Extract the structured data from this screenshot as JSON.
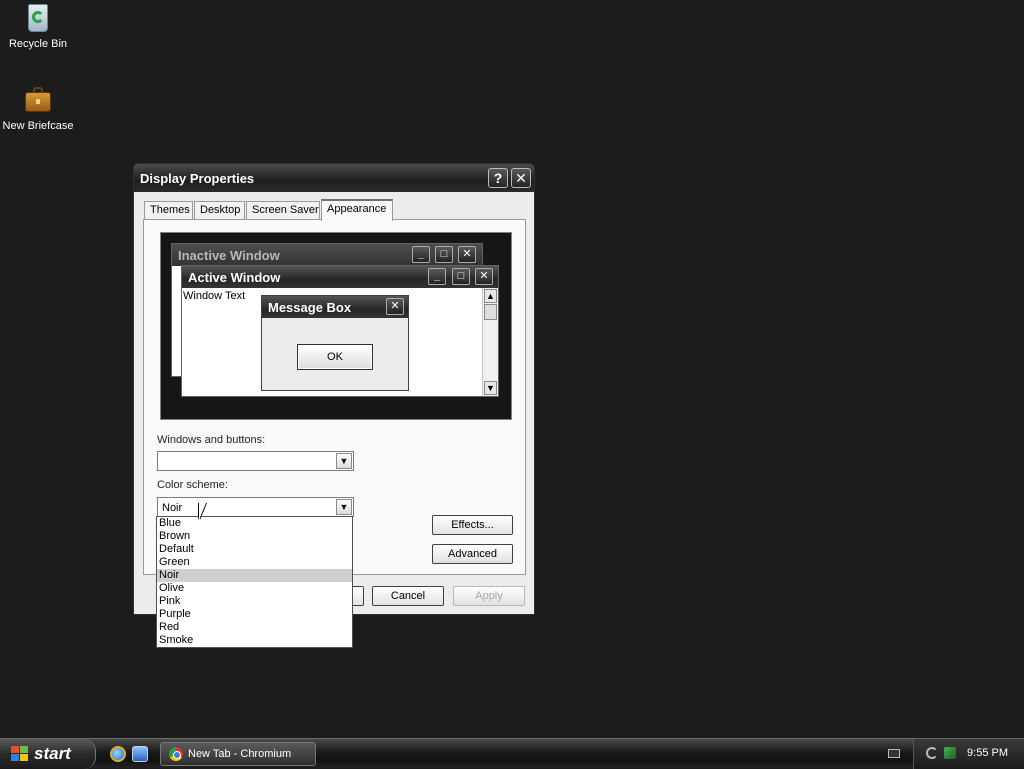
{
  "desktop": {
    "icons": [
      {
        "label": "Recycle Bin",
        "icon": "recycle-bin-icon"
      },
      {
        "label": "New Briefcase",
        "icon": "briefcase-icon"
      }
    ]
  },
  "dialog": {
    "title": "Display Properties",
    "help_symbol": "?",
    "close_symbol": "✕",
    "tabs": [
      {
        "label": "Themes"
      },
      {
        "label": "Desktop"
      },
      {
        "label": "Screen Saver"
      },
      {
        "label": "Appearance",
        "active": true
      }
    ],
    "preview": {
      "inactive_title": "Inactive Window",
      "active_title": "Active Window",
      "window_text": "Window Text",
      "message_box_title": "Message Box",
      "ok_label": "OK"
    },
    "windows_buttons_label": "Windows and buttons:",
    "windows_buttons_value": "",
    "color_scheme_label": "Color scheme:",
    "color_scheme_value": "Noir",
    "effects_label": "Effects...",
    "advanced_label": "Advanced",
    "cancel_label": "Cancel",
    "apply_label": "Apply"
  },
  "dropdown": {
    "options": [
      "Blue",
      "Brown",
      "Default",
      "Green",
      "Noir",
      "Olive",
      "Pink",
      "Purple",
      "Red",
      "Smoke"
    ],
    "selected": "Noir"
  },
  "taskbar": {
    "start_label": "start",
    "task_label": "New Tab - Chromium",
    "clock": "9:55 PM"
  },
  "colors": {
    "desktop_bg": "#1c1c1c",
    "title_bar": "#262626",
    "dialog_bg": "#ececec",
    "selection": "#d0d0d0"
  }
}
